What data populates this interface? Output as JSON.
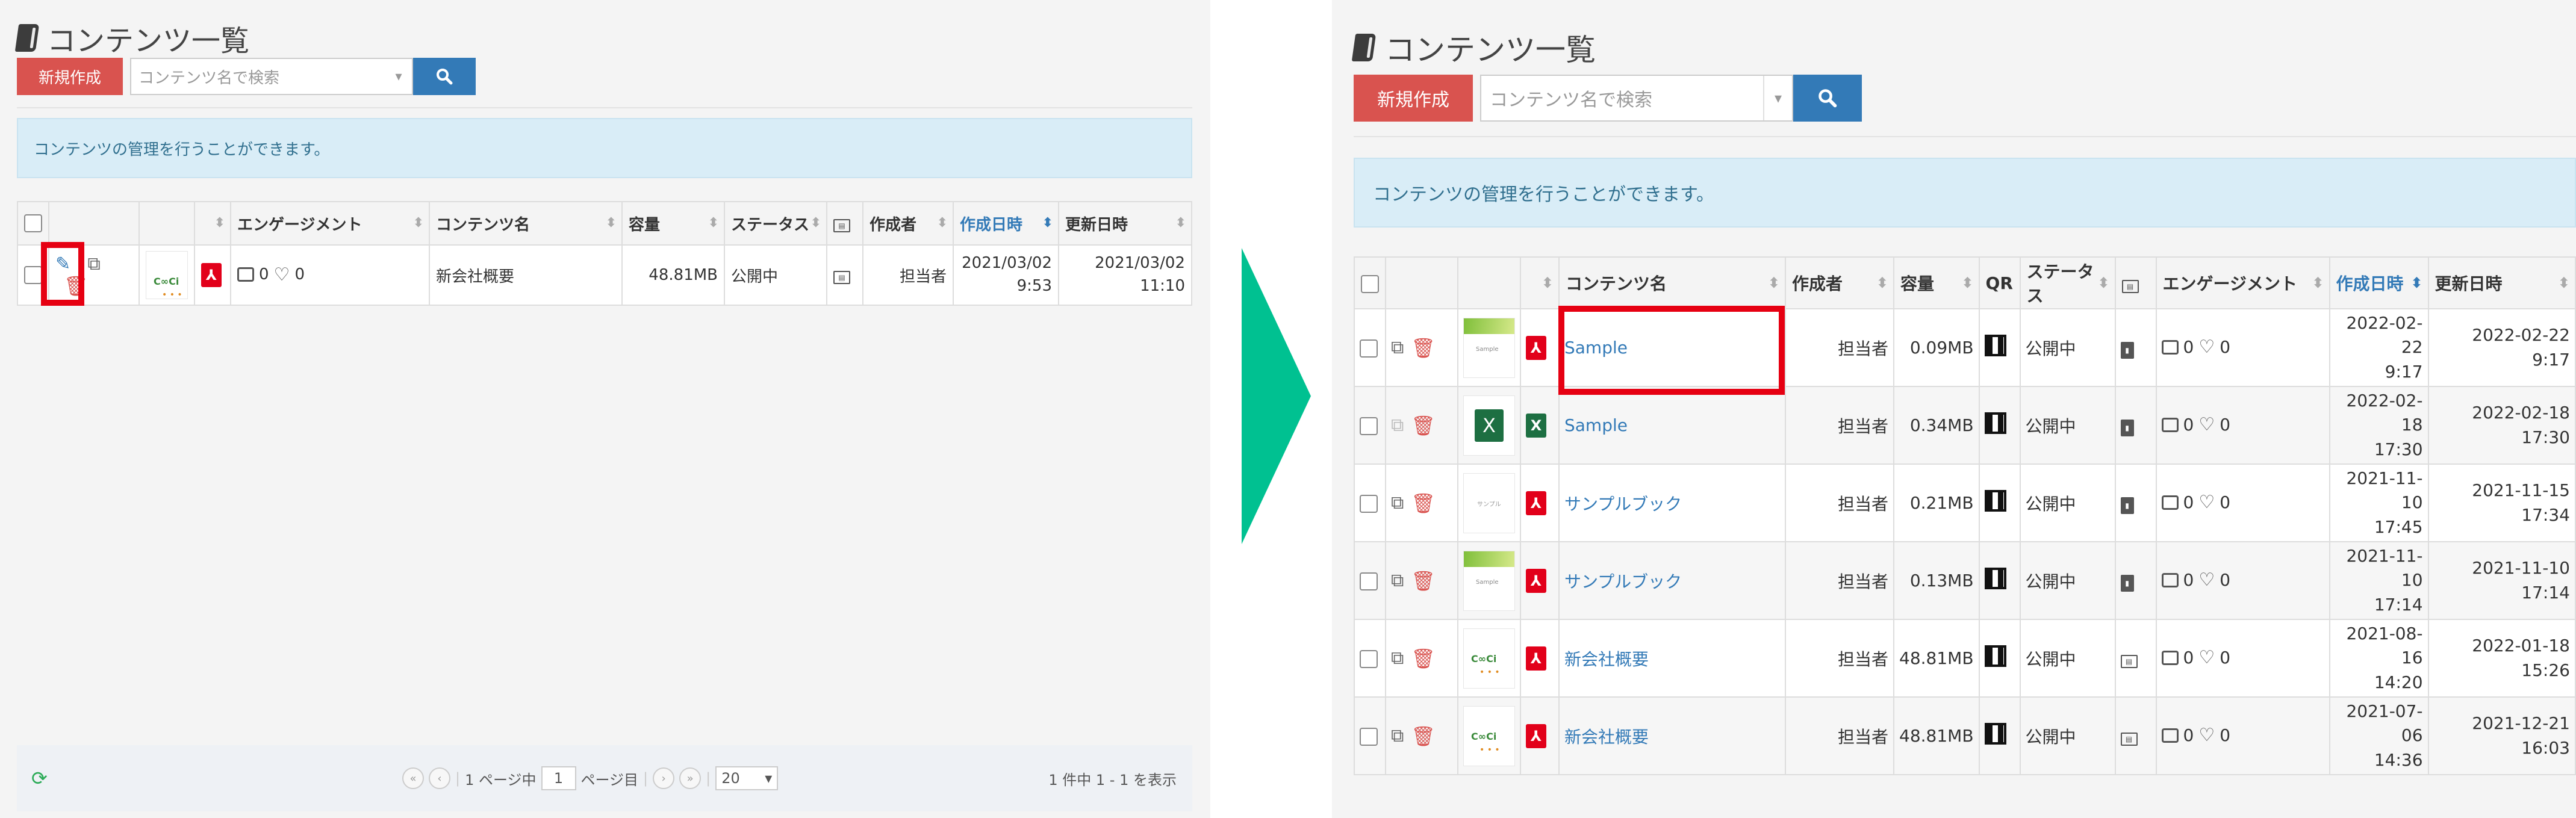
{
  "left": {
    "page_title": "コンテンツ一覧",
    "new_button": "新規作成",
    "search_placeholder": "コンテンツ名で検索",
    "info_message": "コンテンツの管理を行うことができます。",
    "columns": [
      "エンゲージメント",
      "コンテンツ名",
      "容量",
      "ステータス",
      "作成者",
      "作成日時",
      "更新日時"
    ],
    "sorted_column": "作成日時",
    "rows": [
      {
        "name": "新会社概要",
        "comments": "0",
        "likes": "0",
        "size": "48.81MB",
        "status": "公開中",
        "creator": "担当者",
        "created_date": "2021/03/02",
        "created_time": "9:53",
        "updated_date": "2021/03/02",
        "updated_time": "11:10",
        "file_type": "pdf",
        "highlight": "edit-button"
      }
    ],
    "pagination": {
      "prefix": "1 ページ中",
      "current_page": "1",
      "suffix": "ページ目",
      "per_page": "20",
      "summary": "1 件中 1 - 1 を表示"
    }
  },
  "right": {
    "page_title": "コンテンツ一覧",
    "new_button": "新規作成",
    "search_placeholder": "コンテンツ名で検索",
    "info_message": "コンテンツの管理を行うことができます。",
    "columns": [
      "コンテンツ名",
      "作成者",
      "容量",
      "QR",
      "ステータス",
      "エンゲージメント",
      "作成日時",
      "更新日時"
    ],
    "sorted_column": "作成日時",
    "rows": [
      {
        "name": "Sample",
        "creator": "担当者",
        "size": "0.09MB",
        "status": "公開中",
        "comments": "0",
        "likes": "0",
        "created_date": "2022-02-22",
        "created_time": "9:17",
        "updated_date": "2022-02-22",
        "updated_time": "9:17",
        "file_type": "pdf",
        "thumb": "green",
        "kind": "book"
      },
      {
        "name": "Sample",
        "creator": "担当者",
        "size": "0.34MB",
        "status": "公開中",
        "comments": "0",
        "likes": "0",
        "created_date": "2022-02-18",
        "created_time": "17:30",
        "updated_date": "2022-02-18",
        "updated_time": "17:30",
        "file_type": "excel",
        "thumb": "xls",
        "kind": "book"
      },
      {
        "name": "サンプルブック",
        "creator": "担当者",
        "size": "0.21MB",
        "status": "公開中",
        "comments": "0",
        "likes": "0",
        "created_date": "2021-11-10",
        "created_time": "17:45",
        "updated_date": "2021-11-15",
        "updated_time": "17:34",
        "file_type": "pdf",
        "thumb": "book",
        "kind": "book"
      },
      {
        "name": "サンプルブック",
        "creator": "担当者",
        "size": "0.13MB",
        "status": "公開中",
        "comments": "0",
        "likes": "0",
        "created_date": "2021-11-10",
        "created_time": "17:14",
        "updated_date": "2021-11-10",
        "updated_time": "17:14",
        "file_type": "pdf",
        "thumb": "green",
        "kind": "book"
      },
      {
        "name": "新会社概要",
        "creator": "担当者",
        "size": "48.81MB",
        "status": "公開中",
        "comments": "0",
        "likes": "0",
        "created_date": "2021-08-16",
        "created_time": "14:20",
        "updated_date": "2022-01-18",
        "updated_time": "15:26",
        "file_type": "pdf",
        "thumb": "corp",
        "kind": "card"
      },
      {
        "name": "新会社概要",
        "creator": "担当者",
        "size": "48.81MB",
        "status": "公開中",
        "comments": "0",
        "likes": "0",
        "created_date": "2021-07-06",
        "created_time": "14:36",
        "updated_date": "2021-12-21",
        "updated_time": "16:03",
        "file_type": "pdf",
        "thumb": "corp",
        "kind": "card"
      }
    ],
    "highlight": "content-name-cell-row-1"
  },
  "colors": {
    "new_button": "#d9534f",
    "search_button": "#337ab7",
    "info_bg": "#d9edf7",
    "info_text": "#31708f",
    "highlight_box": "#e60012",
    "arrow": "#00c191",
    "link": "#337ab7"
  }
}
